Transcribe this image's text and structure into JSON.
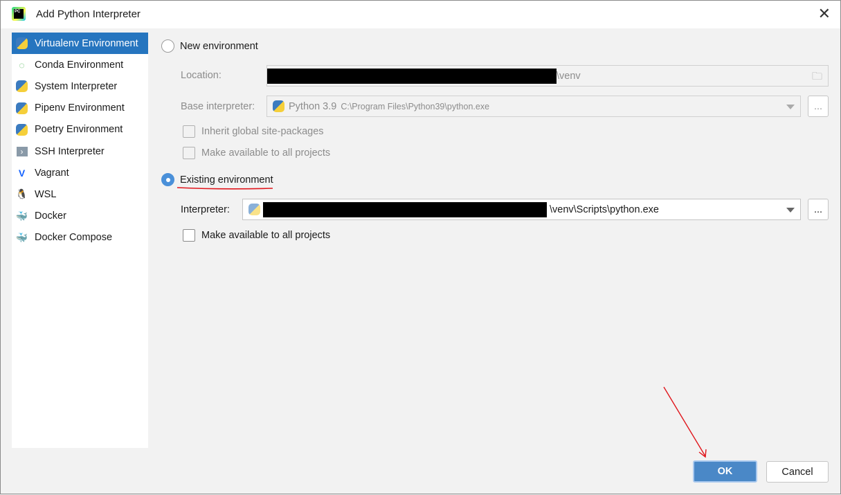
{
  "window": {
    "title": "Add Python Interpreter",
    "app_icon_text": "PC"
  },
  "sidebar": {
    "items": [
      {
        "label": "Virtualenv Environment",
        "icon": "virtualenv-icon",
        "selected": true
      },
      {
        "label": "Conda Environment",
        "icon": "conda-icon"
      },
      {
        "label": "System Interpreter",
        "icon": "python-icon"
      },
      {
        "label": "Pipenv Environment",
        "icon": "pipenv-icon"
      },
      {
        "label": "Poetry Environment",
        "icon": "poetry-icon"
      },
      {
        "label": "SSH Interpreter",
        "icon": "ssh-icon"
      },
      {
        "label": "Vagrant",
        "icon": "vagrant-icon"
      },
      {
        "label": "WSL",
        "icon": "linux-icon"
      },
      {
        "label": "Docker",
        "icon": "docker-icon"
      },
      {
        "label": "Docker Compose",
        "icon": "docker-compose-icon"
      }
    ]
  },
  "new_env": {
    "label": "New environment",
    "selected": false,
    "location_label": "Location:",
    "location_suffix": "\\venv",
    "base_label": "Base interpreter:",
    "base_version": "Python 3.9",
    "base_path": "C:\\Program Files\\Python39\\python.exe",
    "inherit_label": "Inherit global site-packages",
    "make_available_label": "Make available to all projects"
  },
  "existing_env": {
    "label": "Existing environment",
    "selected": true,
    "interpreter_label": "Interpreter:",
    "interpreter_suffix": "\\venv\\Scripts\\python.exe",
    "make_available_label": "Make available to all projects"
  },
  "buttons": {
    "browse": "...",
    "ok": "OK",
    "cancel": "Cancel"
  },
  "colors": {
    "accent": "#2675bf",
    "ok": "#4a88c7",
    "annotation": "#e0151b"
  }
}
